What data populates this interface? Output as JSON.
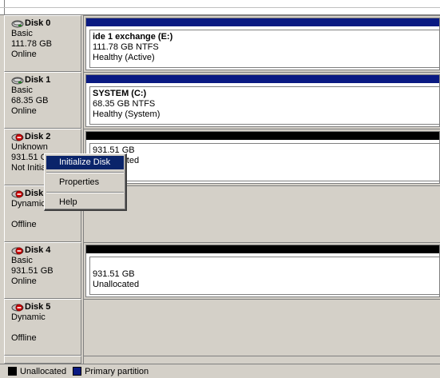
{
  "disks": [
    {
      "name": "Disk 0",
      "type": "Basic",
      "size": "111.78 GB",
      "status": "Online",
      "icon": "disk-ok",
      "volume": {
        "band": "primary",
        "name": "ide 1 exchange  (E:)",
        "size": "111.78 GB NTFS",
        "health": "Healthy (Active)"
      }
    },
    {
      "name": "Disk 1",
      "type": "Basic",
      "size": "68.35 GB",
      "status": "Online",
      "icon": "disk-ok",
      "volume": {
        "band": "primary",
        "name": "SYSTEM  (C:)",
        "size": "68.35 GB NTFS",
        "health": "Healthy (System)"
      }
    },
    {
      "name": "Disk 2",
      "type": "Unknown",
      "size": "931.51 GB",
      "status": "Not Initialized",
      "icon": "disk-error",
      "volume": {
        "band": "unalloc",
        "name": "",
        "size": "931.51 GB",
        "health": "Unallocated"
      }
    },
    {
      "name": "Disk 3",
      "type": "Dynamic",
      "size": "",
      "status": "Offline",
      "icon": "disk-error"
    },
    {
      "name": "Disk 4",
      "type": "Basic",
      "size": "931.51 GB",
      "status": "Online",
      "icon": "disk-error",
      "volume": {
        "band": "unalloc",
        "name": "",
        "size": "931.51 GB",
        "health": "Unallocated"
      }
    },
    {
      "name": "Disk 5",
      "type": "Dynamic",
      "size": "",
      "status": "Offline",
      "icon": "disk-error"
    }
  ],
  "context_menu": {
    "items": [
      {
        "label": "Initialize Disk",
        "accel": "I",
        "selected": true
      },
      {
        "label": "Properties",
        "accel": "P"
      },
      {
        "label": "Help",
        "accel": "H"
      }
    ]
  },
  "legend": [
    {
      "label": "Unallocated",
      "color": "#000000"
    },
    {
      "label": "Primary partition",
      "color": "#0a1a82"
    }
  ]
}
